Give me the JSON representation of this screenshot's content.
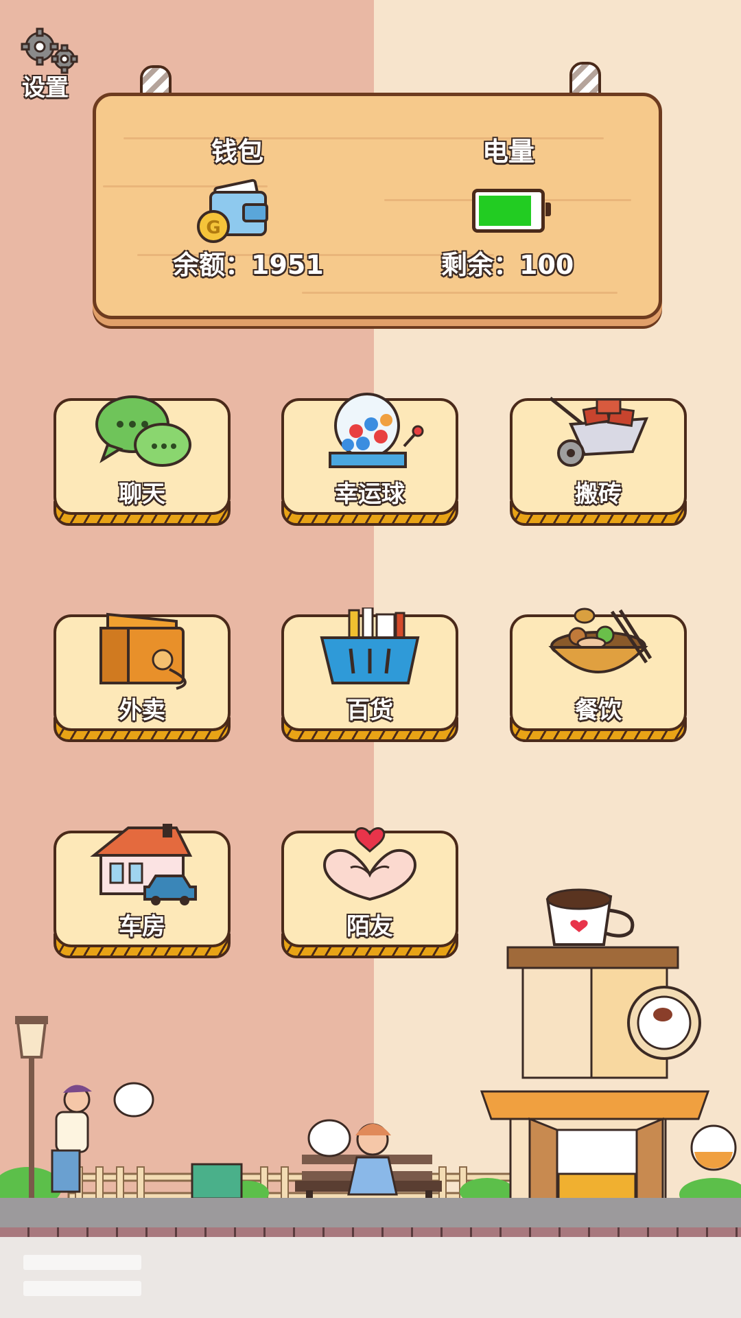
{
  "settings": {
    "label": "设置",
    "icon": "gear-icon"
  },
  "wallet": {
    "title": "钱包",
    "balance_text": "余额：1951",
    "icon": "wallet-icon"
  },
  "power": {
    "title": "电量",
    "remaining_text": "剩余：100",
    "level": 1.0,
    "icon": "battery-icon",
    "color": "#22cc22"
  },
  "menu": {
    "items": [
      {
        "label": "聊天",
        "icon": "chat-bubbles-icon"
      },
      {
        "label": "幸运球",
        "icon": "lottery-machine-icon"
      },
      {
        "label": "搬砖",
        "icon": "wheelbarrow-bricks-icon"
      },
      {
        "label": "外卖",
        "icon": "delivery-box-icon"
      },
      {
        "label": "百货",
        "icon": "shopping-basket-icon"
      },
      {
        "label": "餐饮",
        "icon": "food-bowl-icon"
      },
      {
        "label": "车房",
        "icon": "house-car-icon"
      },
      {
        "label": "陌友",
        "icon": "heart-hands-icon"
      }
    ]
  },
  "colors": {
    "bg_left": "#e9b8a4",
    "bg_right": "#f7e4cc",
    "board": "#f6c98b",
    "tile": "#fde8b8",
    "tile_base": "#e8a316"
  }
}
